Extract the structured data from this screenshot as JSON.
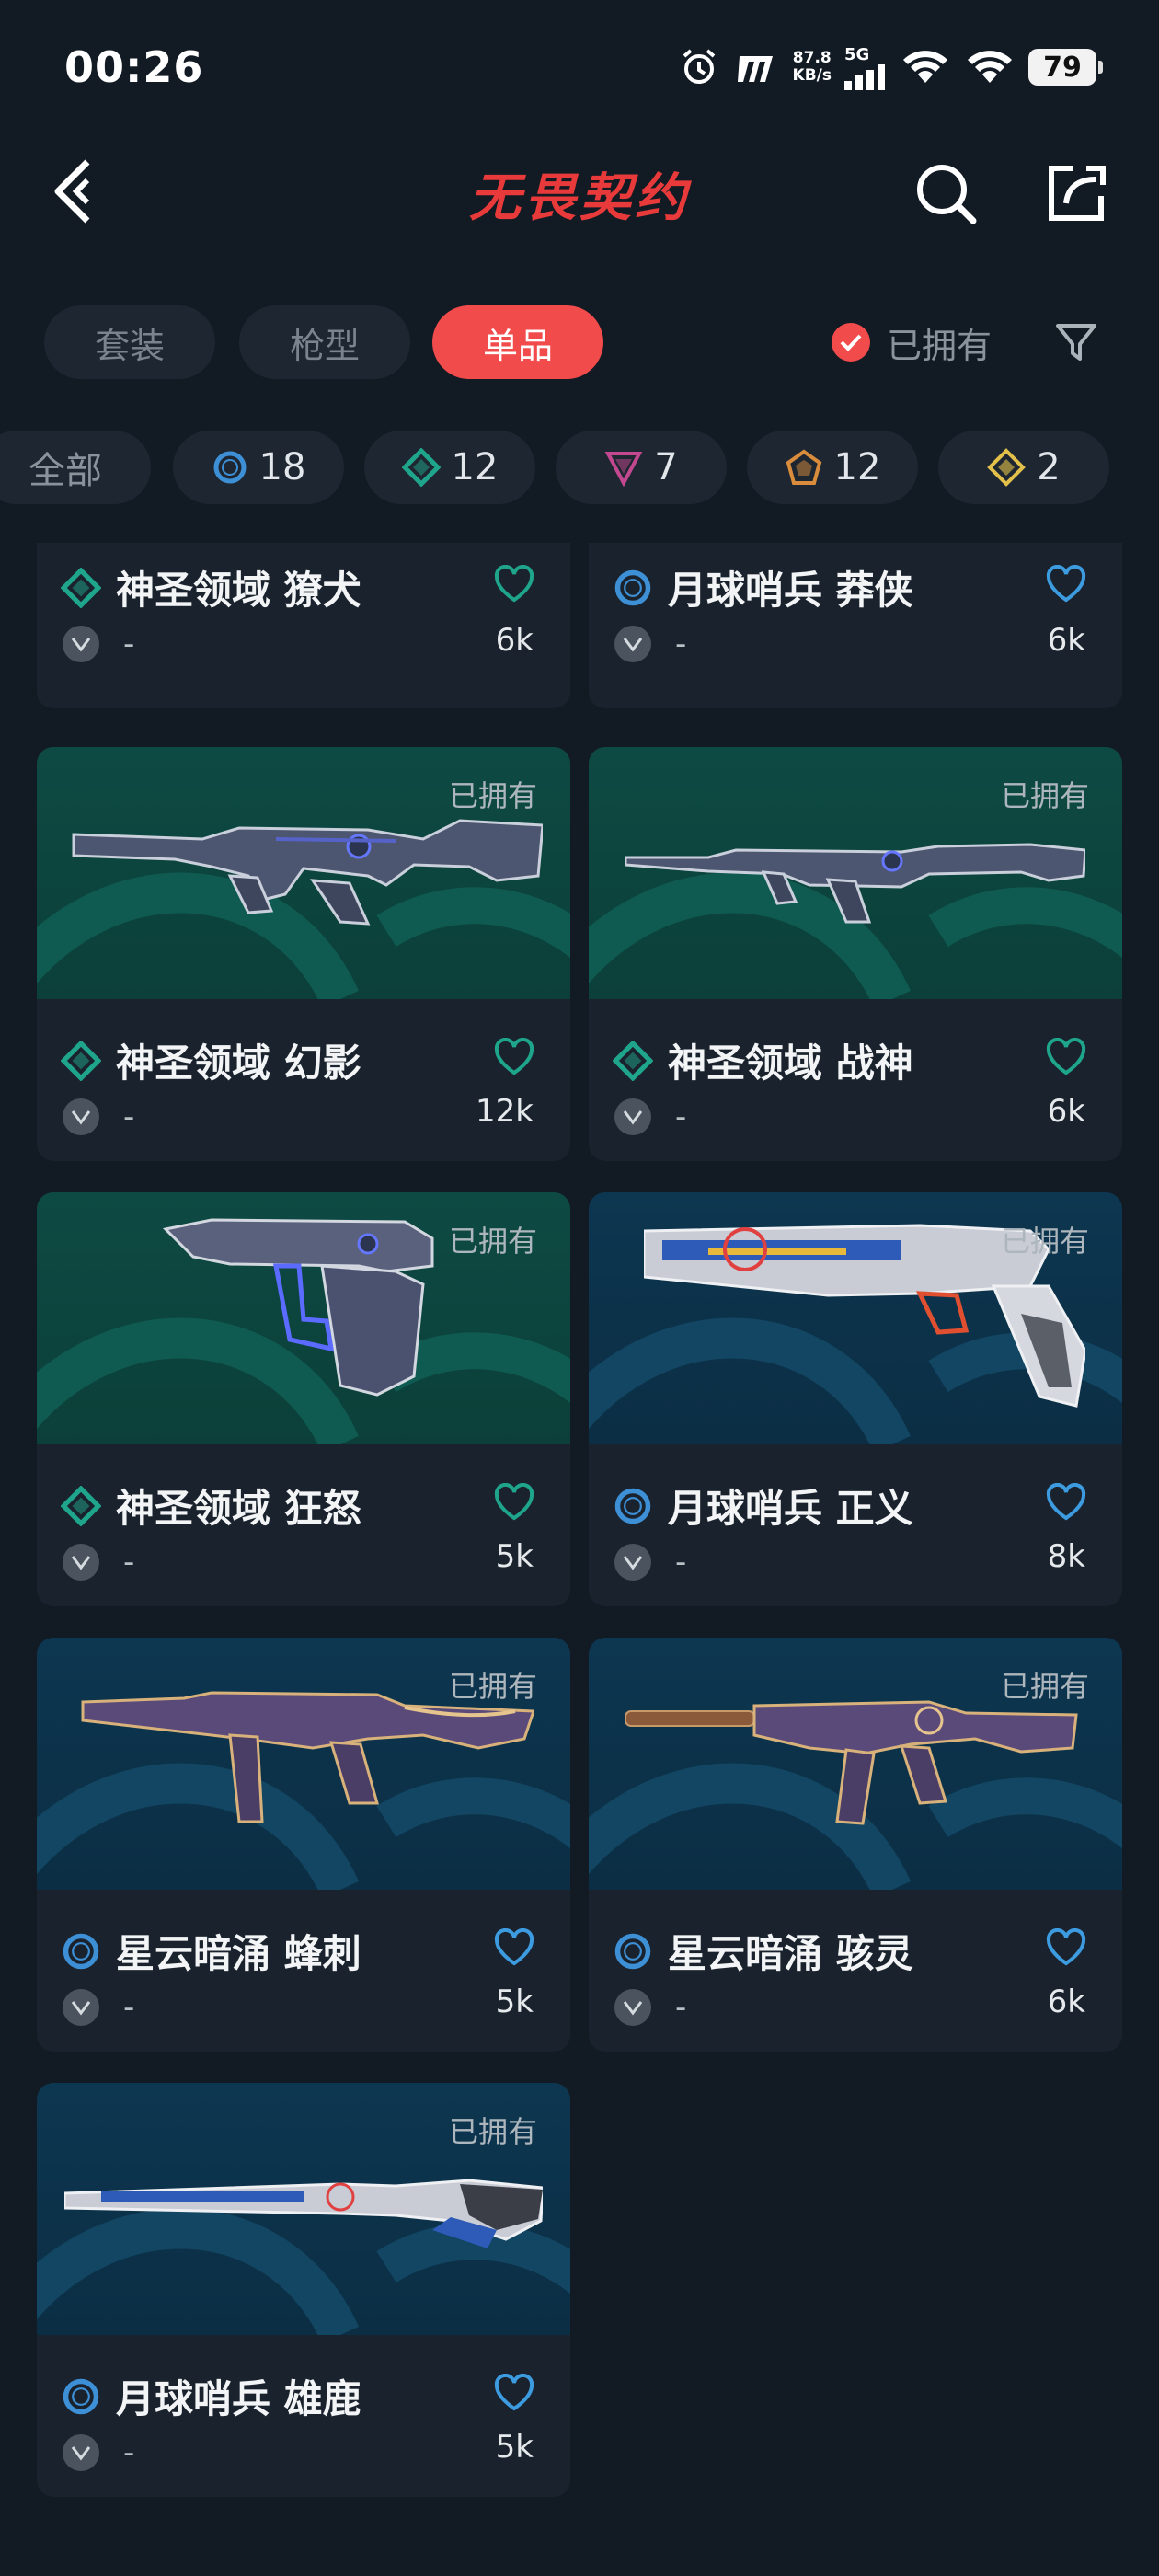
{
  "status": {
    "time": "00:26",
    "speed_value": "87.8",
    "speed_unit": "KB/s",
    "network": "5G",
    "battery": "79"
  },
  "header": {
    "title": "无畏契约"
  },
  "tabs": [
    {
      "label": "套装",
      "active": false
    },
    {
      "label": "枪型",
      "active": false
    },
    {
      "label": "单品",
      "active": true
    }
  ],
  "owned_filter": {
    "label": "已拥有",
    "checked": true
  },
  "tiers": [
    {
      "label": "全部",
      "icon": "none"
    },
    {
      "label": "18",
      "icon": "select-tier-icon",
      "color": "#3d8fd6"
    },
    {
      "label": "12",
      "icon": "deluxe-tier-icon",
      "color": "#1fa58c"
    },
    {
      "label": "7",
      "icon": "premium-tier-icon",
      "color": "#c4488f"
    },
    {
      "label": "12",
      "icon": "ultra-tier-icon",
      "color": "#d98c3c"
    },
    {
      "label": "2",
      "icon": "exclusive-tier-icon",
      "color": "#e2c04a"
    }
  ],
  "owned_badge": "已拥有",
  "items": [
    {
      "name": "神圣领域 獠犬",
      "tier": "deluxe",
      "price": "-",
      "favorites": "6k",
      "owned": true
    },
    {
      "name": "月球哨兵 莽侠",
      "tier": "select",
      "price": "-",
      "favorites": "6k",
      "owned": true
    },
    {
      "name": "神圣领域 幻影",
      "tier": "deluxe",
      "price": "-",
      "favorites": "12k",
      "owned": true
    },
    {
      "name": "神圣领域 战神",
      "tier": "deluxe",
      "price": "-",
      "favorites": "6k",
      "owned": true
    },
    {
      "name": "神圣领域 狂怒",
      "tier": "deluxe",
      "price": "-",
      "favorites": "5k",
      "owned": true
    },
    {
      "name": "月球哨兵 正义",
      "tier": "select",
      "price": "-",
      "favorites": "8k",
      "owned": true
    },
    {
      "name": "星云暗涌 蜂刺",
      "tier": "select",
      "price": "-",
      "favorites": "5k",
      "owned": true
    },
    {
      "name": "星云暗涌 骇灵",
      "tier": "select",
      "price": "-",
      "favorites": "6k",
      "owned": true
    },
    {
      "name": "月球哨兵 雄鹿",
      "tier": "select",
      "price": "-",
      "favorites": "5k",
      "owned": true
    }
  ]
}
